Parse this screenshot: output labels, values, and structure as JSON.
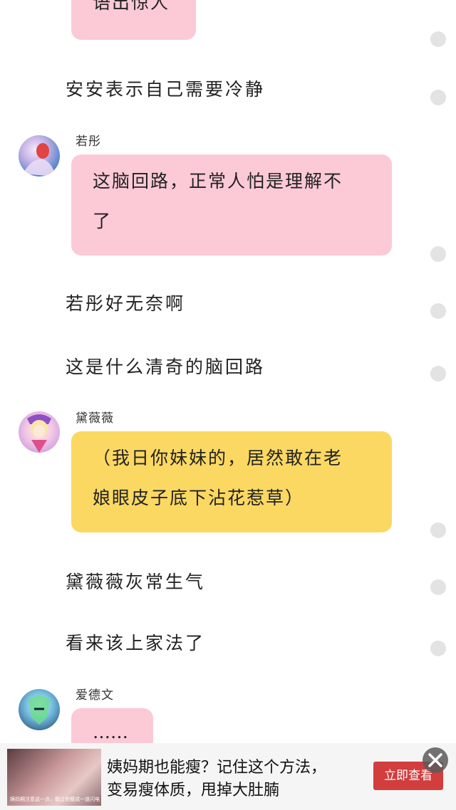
{
  "messages": {
    "m1_text": "语出惊人",
    "n1": "安安表示自己需要冷静",
    "m2_sender": "若彤",
    "m2_line1": "这脑回路，正常人怕是理解不",
    "m2_line2": "了",
    "n2": "若彤好无奈啊",
    "n3": "这是什么清奇的脑回路",
    "m3_sender": "黛薇薇",
    "m3_line1": "（我日你妹妹的，居然敢在老",
    "m3_line2": "娘眼皮子底下沾花惹草）",
    "n4": "黛薇薇灰常生气",
    "n5": "看来该上家法了",
    "m4_sender": "爱德文",
    "m4_text": "……"
  },
  "ad": {
    "line1": "姨妈期也能瘦？记住这个方法，",
    "line2": "变易瘦体质，甩掉大肚腩",
    "button": "立即查看",
    "image_caption": "姨妈期注意这一点，能让你瘦成一道闪电"
  },
  "colors": {
    "pink_bubble": "#fbcad6",
    "yellow_bubble": "#fbd862",
    "ad_button": "#d23d3d"
  },
  "icons": {
    "close": "close-icon",
    "read_dot": "circle-dot"
  }
}
